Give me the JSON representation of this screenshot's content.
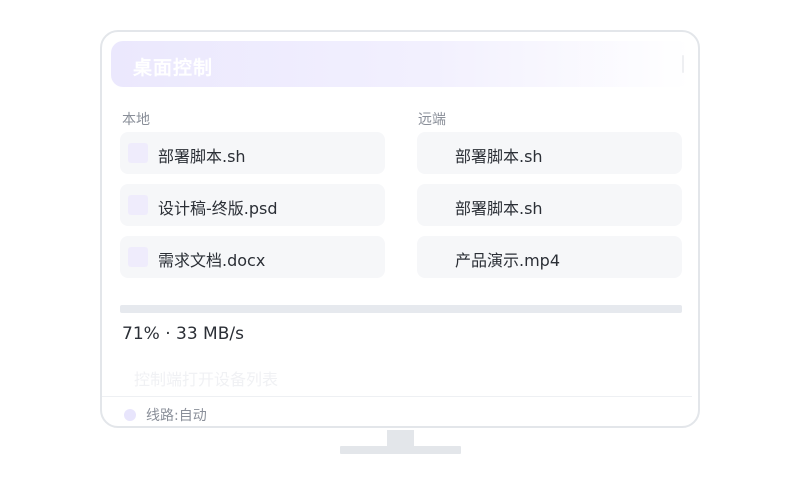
{
  "window": {
    "title": "桌面控制"
  },
  "columns": {
    "local_label": "本地",
    "remote_label": "远端"
  },
  "local_files": [
    {
      "name": "部署脚本.sh"
    },
    {
      "name": "设计稿-终版.psd"
    },
    {
      "name": "需求文档.docx"
    }
  ],
  "remote_files": [
    {
      "name": "部署脚本.sh"
    },
    {
      "name": "部署脚本.sh"
    },
    {
      "name": "产品演示.mp4"
    }
  ],
  "transfer": {
    "progress_text": "71% · 33 MB/s"
  },
  "hint": {
    "text": "控制端打开设备列表"
  },
  "status": {
    "text": "线路:自动"
  },
  "colors": {
    "accent": "#ebe8fd",
    "icon_tint": "#efecfc",
    "border": "#e3e6ea"
  },
  "icons": {
    "file": "file-icon",
    "status": "status-dot-icon"
  }
}
